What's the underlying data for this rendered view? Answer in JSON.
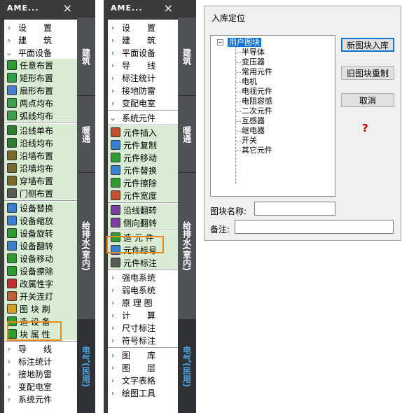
{
  "panel_left": {
    "title": "AME...",
    "close": "×",
    "items": [
      {
        "label": "设　　置",
        "chev": "›",
        "green": false
      },
      {
        "label": "建　　筑",
        "chev": "›",
        "green": false
      },
      {
        "label": "平面设备",
        "chev": "⌄",
        "green": false
      },
      {
        "label": "任意布置",
        "icon": "#2f9c2f",
        "green": true
      },
      {
        "label": "矩形布置",
        "icon": "#2fa14a",
        "green": true
      },
      {
        "label": "扇形布置",
        "icon": "#4a7fd0",
        "green": true
      },
      {
        "label": "两点均布",
        "icon": "#3aa04a",
        "green": true
      },
      {
        "label": "弧线均布",
        "icon": "#3aa04a",
        "green": true
      },
      {
        "label": "沿线单布",
        "icon": "#2f7d2f",
        "green": true
      },
      {
        "label": "沿线均布",
        "icon": "#2f7d2f",
        "green": true
      },
      {
        "label": "沿墙布置",
        "icon": "#7a6a2a",
        "green": true
      },
      {
        "label": "沿墙均布",
        "icon": "#7a6a2a",
        "green": true
      },
      {
        "label": "穿墙布置",
        "icon": "#7a6a2a",
        "green": true
      },
      {
        "label": "门侧布置",
        "icon": "#5a5a5a",
        "green": true
      },
      {
        "label": "设备替换",
        "icon": "#3a7fd0",
        "green": true
      },
      {
        "label": "设备缩放",
        "icon": "#3a7fd0",
        "green": true
      },
      {
        "label": "设备旋转",
        "icon": "#2f9c2f",
        "green": true
      },
      {
        "label": "设备翻转",
        "icon": "#3a7fd0",
        "green": true
      },
      {
        "label": "设备移动",
        "icon": "#2f9c2f",
        "green": true
      },
      {
        "label": "设备擦除",
        "icon": "#2f9c2f",
        "green": true
      },
      {
        "label": "改属性字",
        "icon": "#c03030",
        "green": true
      },
      {
        "label": "开关连灯",
        "icon": "#c06030",
        "green": true
      },
      {
        "label": "图 块 刷",
        "icon": "#d0a020",
        "green": true
      },
      {
        "label": "造 设 备",
        "icon": "#2f9c2f",
        "green": true
      },
      {
        "label": "块 属 性",
        "icon": "#2f9c2f",
        "green": true
      },
      {
        "label": "导　　线",
        "chev": "›",
        "green": false
      },
      {
        "label": "标注统计",
        "chev": "›",
        "green": false
      },
      {
        "label": "接地防雷",
        "chev": "›",
        "green": false
      },
      {
        "label": "变配电室",
        "chev": "›",
        "green": false
      },
      {
        "label": "系统元件",
        "chev": "›",
        "green": false
      }
    ],
    "tabs": [
      "建筑",
      "暖通",
      "给排水(室内)",
      "电气(民用)"
    ]
  },
  "panel_right": {
    "title": "AME...",
    "close": "×",
    "items": [
      {
        "label": "设　　置",
        "chev": "›",
        "green": false
      },
      {
        "label": "建　　筑",
        "chev": "›",
        "green": false
      },
      {
        "label": "平面设备",
        "chev": "›",
        "green": false
      },
      {
        "label": "导　　线",
        "chev": "›",
        "green": false
      },
      {
        "label": "标注统计",
        "chev": "›",
        "green": false
      },
      {
        "label": "接地防雷",
        "chev": "›",
        "green": false
      },
      {
        "label": "变配电室",
        "chev": "›",
        "green": false
      },
      {
        "label": "系统元件",
        "chev": "⌄",
        "green": false
      },
      {
        "label": "元件插入",
        "icon": "#c05030",
        "green": true
      },
      {
        "label": "元件复制",
        "icon": "#3a7fd0",
        "green": true
      },
      {
        "label": "元件移动",
        "icon": "#2f9c2f",
        "green": true
      },
      {
        "label": "元件替换",
        "icon": "#3a7fd0",
        "green": true
      },
      {
        "label": "元件擦除",
        "icon": "#2f9c2f",
        "green": true
      },
      {
        "label": "元件宽度",
        "icon": "#c05030",
        "green": true
      },
      {
        "label": "沿线翻转",
        "icon": "#7a40a0",
        "green": true
      },
      {
        "label": "侧向翻转",
        "icon": "#7a40a0",
        "green": true
      },
      {
        "label": "造 元 件",
        "icon": "#2f9c2f",
        "green": true
      },
      {
        "label": "元件标号",
        "icon": "#3a7fd0",
        "green": true
      },
      {
        "label": "元件标注",
        "icon": "#5a5a5a",
        "green": true
      },
      {
        "label": "强电系统",
        "chev": "›",
        "green": false
      },
      {
        "label": "弱电系统",
        "chev": "›",
        "green": false
      },
      {
        "label": "原 理 图",
        "chev": "›",
        "green": false
      },
      {
        "label": "计　　算",
        "chev": "›",
        "green": false
      },
      {
        "label": "尺寸标注",
        "chev": "›",
        "green": false
      },
      {
        "label": "符号标注",
        "chev": "›",
        "green": false
      },
      {
        "label": "图　　库",
        "chev": "›",
        "green": false
      },
      {
        "label": "图　　层",
        "chev": "›",
        "green": false
      },
      {
        "label": "文字表格",
        "chev": "›",
        "green": false
      },
      {
        "label": "绘图工具",
        "chev": "›",
        "green": false
      }
    ],
    "tabs": [
      "建筑",
      "暖通",
      "给排水(室内)",
      "电气(民用)"
    ]
  },
  "dialog": {
    "title": "入库定位",
    "tree_root": "用户图块",
    "tree_expander": "−",
    "tree_children": [
      "半导体",
      "变压器",
      "常用元件",
      "电机",
      "电视元件",
      "电阻容感",
      "二次元件",
      "互感器",
      "继电器",
      "开关",
      "其它元件"
    ],
    "buttons": {
      "new_block": "新图块入库",
      "redefine": "旧图块重制",
      "cancel": "取消"
    },
    "help": "?",
    "name_label": "图块名称:",
    "name_value": "",
    "note_label": "备注:",
    "note_value": ""
  },
  "colors": {
    "accent": "#e8891c",
    "selection": "#0a74d8",
    "green_row": "#d8ecd3",
    "active_tab_text": "#4aa3e0"
  }
}
